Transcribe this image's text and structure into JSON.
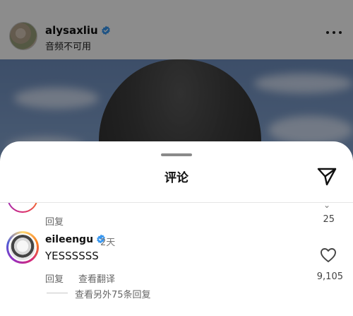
{
  "post": {
    "username": "alysaxliu",
    "subtitle": "音频不可用"
  },
  "icons": {
    "verified": "verified-badge-icon",
    "more": "more-horizontal-icon",
    "share": "send-icon",
    "heart": "heart-outline-icon"
  },
  "colors": {
    "verified": "#3897f0",
    "overlay": "rgba(0,0,0,0.45)"
  },
  "sheet": {
    "title": "评论"
  },
  "comments": {
    "previous": {
      "reply_label": "回复",
      "like_count": "25"
    },
    "current": {
      "username": "eileengu",
      "time": "2天",
      "text": "YESSSSSS",
      "reply_label": "回复",
      "translate_label": "查看翻译",
      "like_count": "9,105",
      "view_more_replies": "查看另外75条回复"
    }
  }
}
